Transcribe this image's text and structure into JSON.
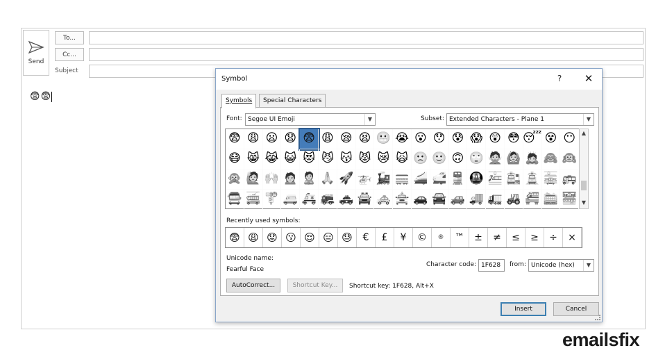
{
  "compose": {
    "send_label": "Send",
    "to_label": "To...",
    "cc_label": "Cc...",
    "subject_label": "Subject",
    "body_emojis": "😨😨"
  },
  "dialog": {
    "title": "Symbol",
    "help": "?",
    "close": "✕",
    "tabs": [
      "Symbols",
      "Special Characters"
    ],
    "font_label": "Font:",
    "font_value": "Segoe UI Emoji",
    "subset_label": "Subset:",
    "subset_value": "Extended Characters - Plane 1",
    "symbols": [
      "😨",
      "😩",
      "😦",
      "😧",
      "😨",
      "😩",
      "😪",
      "😫",
      "😬",
      "😭",
      "😮",
      "😯",
      "😰",
      "😱",
      "😲",
      "😳",
      "😴",
      "😵",
      "😶",
      "😷",
      "😸",
      "😹",
      "😺",
      "😻",
      "😼",
      "😽",
      "😾",
      "😿",
      "🙀",
      "🙁",
      "🙂",
      "🙃",
      "🙄",
      "🙅",
      "🙆",
      "🙇",
      "🙈",
      "🙉",
      "🙊",
      "🙋",
      "🙌",
      "🙍",
      "🙎",
      "🙏",
      "🚀",
      "🚁",
      "🚂",
      "🚃",
      "🚄",
      "🚅",
      "🚆",
      "🚇",
      "🚈",
      "🚉",
      "🚊",
      "🚋",
      "🚌",
      "🚍",
      "🚎",
      "🚏",
      "🚐",
      "🚑",
      "🚒",
      "🚓",
      "🚔",
      "🚕",
      "🚖",
      "🚗",
      "🚘",
      "🚙",
      "🚚",
      "🚛",
      "🚜",
      "🚝",
      "🚞",
      "🚟"
    ],
    "selected_index": 4,
    "recent_label": "Recently used symbols:",
    "recent": [
      "😨",
      "😩",
      "😟",
      "😗",
      "😌",
      "😑",
      "😓",
      "€",
      "£",
      "¥",
      "©",
      "®",
      "™",
      "±",
      "≠",
      "≤",
      "≥",
      "÷",
      "×"
    ],
    "unicode_name_label": "Unicode name:",
    "unicode_name_value": "Fearful Face",
    "char_code_label": "Character code:",
    "char_code_value": "1F628",
    "from_label": "from:",
    "from_value": "Unicode (hex)",
    "autocorrect_label": "AutoCorrect...",
    "shortcut_key_button": "Shortcut Key...",
    "shortcut_text": "Shortcut key: 1F628, Alt+X",
    "insert_label": "Insert",
    "cancel_label": "Cancel"
  },
  "watermark": "emailsfix"
}
